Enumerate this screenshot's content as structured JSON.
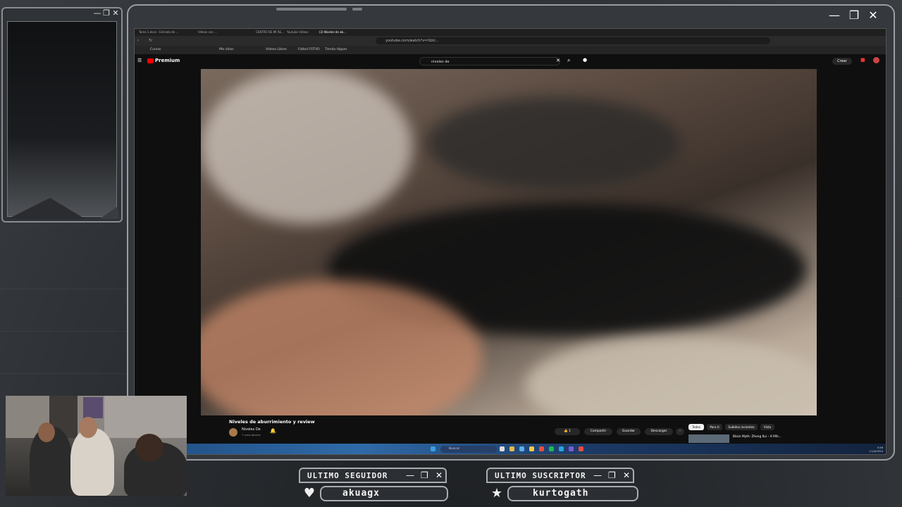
{
  "window_controls": {
    "minimize": "—",
    "maximize": "❐",
    "close": "✕"
  },
  "browser": {
    "tabs": [
      "Tarea 1.docx · Entrada de ...",
      "Videos con ... ",
      "CENTRO DE MI RE...",
      "Youtube Videos",
      "(3) Niveles de ab..."
    ],
    "url": "youtube.com/watch?v=I1bU...",
    "bookmarks": [
      "Cursos",
      "Mis sitios",
      "Videos Libres",
      "Fútbol FOTVO",
      "Tienda Hipper"
    ],
    "youtube": {
      "logo": "Premium",
      "search_value": "niveles de",
      "create_label": "Crear",
      "video_title": "Niveles de aburrimiento y review",
      "channel_name": "Niveles De",
      "channel_subs": "7 suscriptores",
      "actions": {
        "like": "1",
        "share": "Compartir",
        "save": "Guardar",
        "download": "Descargar",
        "more": "···"
      },
      "chips": [
        "Todos",
        "Para ti",
        "Subidos recientes",
        "Visto"
      ],
      "recommendation_title": "Black Myth: Zhong Kui – 6 Mih..."
    },
    "taskbar": {
      "search_placeholder": "Buscar",
      "time": "3:36",
      "date": "11/4/2024"
    }
  },
  "alerts": {
    "follower": {
      "title": "ULTIMO SEGUIDOR",
      "value": "akuagx",
      "icon": "heart-icon"
    },
    "subscriber": {
      "title": "ULTIMO SUSCRIPTOR",
      "value": "kurtogath",
      "icon": "star-icon"
    }
  }
}
